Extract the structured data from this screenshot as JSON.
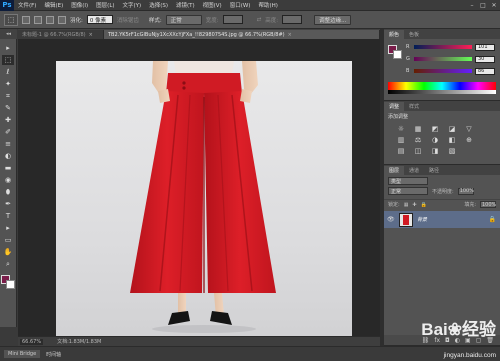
{
  "app": {
    "logo": "Ps"
  },
  "menu": [
    "文件(F)",
    "编辑(E)",
    "图像(I)",
    "图层(L)",
    "文字(Y)",
    "选择(S)",
    "滤镜(T)",
    "视图(V)",
    "窗口(W)",
    "帮助(H)"
  ],
  "window_controls": [
    "–",
    "□",
    "✕"
  ],
  "options": {
    "feather_label": "羽化:",
    "feather_value": "0 像素",
    "antialias_label": "消除锯齿",
    "style_label": "样式:",
    "style_value": "正常",
    "width_label": "宽度:",
    "height_label": "高度:",
    "refine_button": "调整边缘..."
  },
  "tools_header": "◂◂",
  "tools": [
    "▸",
    "⬚",
    "ℓ",
    "✦",
    "⌗",
    "✎",
    "✚",
    "✐",
    "≡",
    "◐",
    "▬",
    "◉",
    "⬮",
    "✒",
    "T",
    "▸",
    "▭",
    "✋",
    "⌕"
  ],
  "colors": {
    "foreground": "#7a1d4a",
    "background": "#ffffff"
  },
  "doc_tabs": [
    {
      "label": "未标题-1 @ 66.7%(RGB/8)",
      "close": "×"
    },
    {
      "label": "TB2.YK5rF1cGlBuNjy1XcXXcYjFXa_!!82980754S.jpg @ 66.7%(RGB/8#)",
      "close": "×"
    }
  ],
  "status": {
    "zoom": "66.67%",
    "doc_info": "文档:1.83M/1.83M"
  },
  "mini_bridge": [
    "Mini Bridge",
    "时间轴"
  ],
  "color_panel": {
    "tabs": [
      "颜色",
      "色板"
    ],
    "channels": [
      {
        "name": "R",
        "value": "101"
      },
      {
        "name": "G",
        "value": "30"
      },
      {
        "name": "B",
        "value": "86"
      }
    ]
  },
  "adjust_panel": {
    "tabs": [
      "调整",
      "样式"
    ],
    "title": "添加调整",
    "icons": [
      "☼",
      "▦",
      "◩",
      "◪",
      "▽",
      "▥",
      "⚖",
      "◑",
      "◧",
      "⊕",
      "▤",
      "◫",
      "◨",
      "▧"
    ]
  },
  "layers_panel": {
    "tabs": [
      "图层",
      "通道",
      "路径"
    ],
    "kind": "类型",
    "blend_mode": "正常",
    "opacity_label": "不透明度:",
    "opacity_value": "100%",
    "lock_label": "锁定:",
    "fill_label": "填充:",
    "fill_value": "100%",
    "layer_name": "背景",
    "footer_icons": [
      "⛓",
      "fx",
      "◘",
      "◐",
      "▣",
      "▢",
      "🗑"
    ]
  },
  "watermark": {
    "main": "Bai❀经验",
    "sub": "jingyan.baidu.com"
  }
}
